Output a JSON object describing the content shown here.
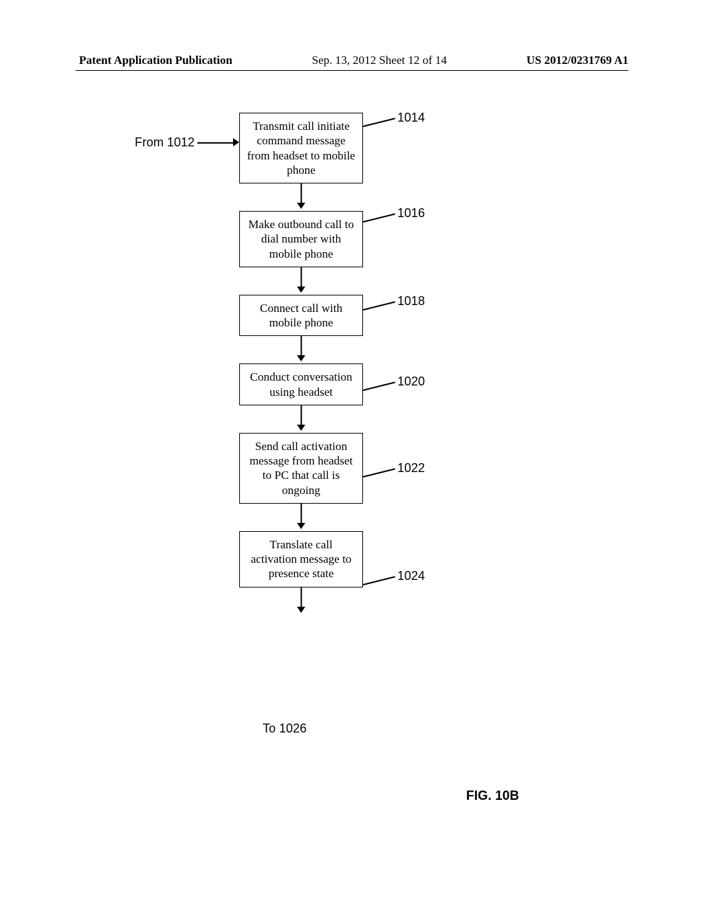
{
  "header": {
    "publication": "Patent Application Publication",
    "date_sheet": "Sep. 13, 2012   Sheet 12 of 14",
    "doc_number": "US 2012/0231769 A1"
  },
  "flow": {
    "from": "From 1012",
    "to": "To 1026",
    "boxes": [
      {
        "text": "Transmit call initiate command message from headset to mobile phone",
        "ref": "1014"
      },
      {
        "text": "Make outbound call to dial number with mobile phone",
        "ref": "1016"
      },
      {
        "text": "Connect call with mobile phone",
        "ref": "1018"
      },
      {
        "text": "Conduct conversation using headset",
        "ref": "1020"
      },
      {
        "text": "Send call activation message from headset to PC that call is ongoing",
        "ref": "1022"
      },
      {
        "text": "Translate call activation message to presence state",
        "ref": "1024"
      }
    ]
  },
  "figure_label": "FIG. 10B"
}
